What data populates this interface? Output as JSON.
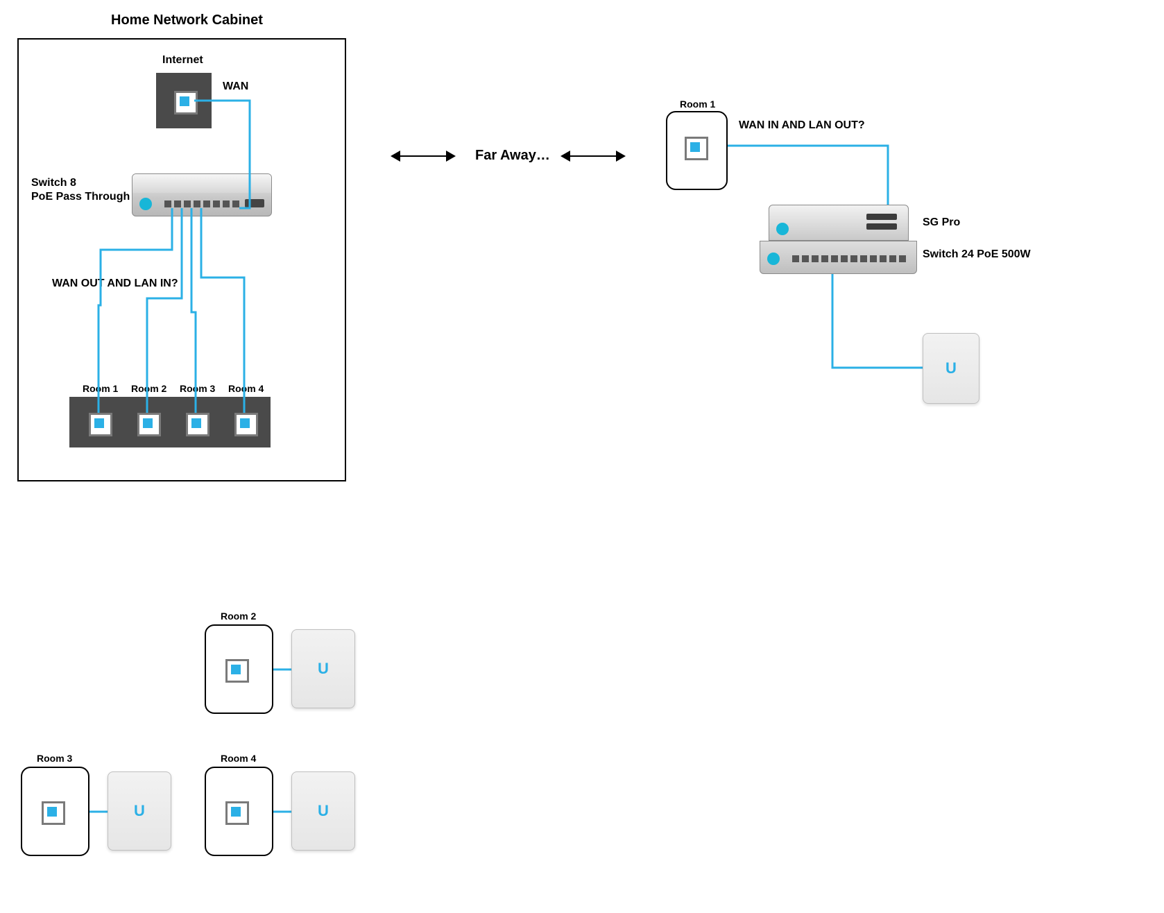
{
  "colors": {
    "cable": "#2bb0e6",
    "panel": "#4a4a4a"
  },
  "cabinet": {
    "title": "Home Network Cabinet",
    "internet_label": "Internet",
    "wan_label": "WAN",
    "switch_label": "Switch 8\nPoE Pass Through",
    "switch_label_line1": "Switch 8",
    "switch_label_line2": "PoE Pass Through",
    "question": "WAN OUT AND LAN IN?",
    "patch": {
      "labels": [
        "Room 1",
        "Room 2",
        "Room 3",
        "Room 4"
      ]
    }
  },
  "between": {
    "text": "Far Away…"
  },
  "remote": {
    "room_label": "Room 1",
    "question": "WAN  IN AND LAN OUT?",
    "sg_label": "SG Pro",
    "switch24_label": "Switch 24 PoE 500W"
  },
  "rooms": {
    "r2": "Room 2",
    "r3": "Room 3",
    "r4": "Room 4"
  },
  "icons": {
    "ap_logo": "U"
  }
}
